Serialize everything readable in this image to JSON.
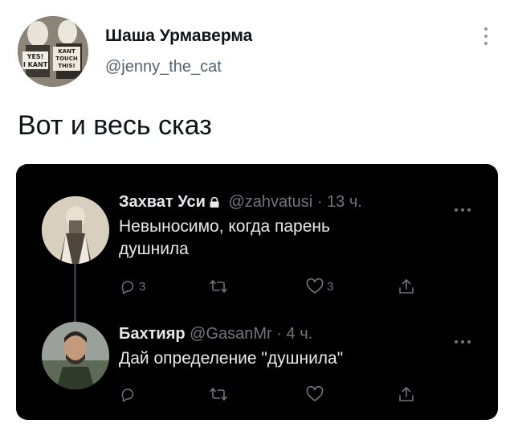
{
  "outer_tweet": {
    "author_name": "Шаша Урмаверма",
    "author_handle": "@jenny_the_cat",
    "avatar_texts": [
      "YES!",
      "I KANT",
      "KANT",
      "TOUCH",
      "THIS!"
    ],
    "text": "Вот и весь сказ",
    "more_icon": "vertical-ellipsis-icon"
  },
  "embedded_thread": [
    {
      "name": "Захват Уси",
      "handle": "@zahvatusi",
      "time": "· 13 ч.",
      "locked": true,
      "text_lines": [
        "Невыносимо, когда парень",
        "душнила"
      ],
      "actions": {
        "reply": "3",
        "retweet": "",
        "like": "3",
        "share": ""
      }
    },
    {
      "name": "Бахтияр",
      "handle": "@GasanMr",
      "time": "· 4 ч.",
      "locked": false,
      "text_lines": [
        "Дай определение \"душнила\""
      ],
      "actions": {
        "reply": "",
        "retweet": "",
        "like": "",
        "share": ""
      }
    }
  ],
  "colors": {
    "text_dark": "#0f1419",
    "muted": "#536471",
    "embed_bg": "#000000",
    "embed_text": "#e7e9ea",
    "embed_muted": "#71767b"
  }
}
